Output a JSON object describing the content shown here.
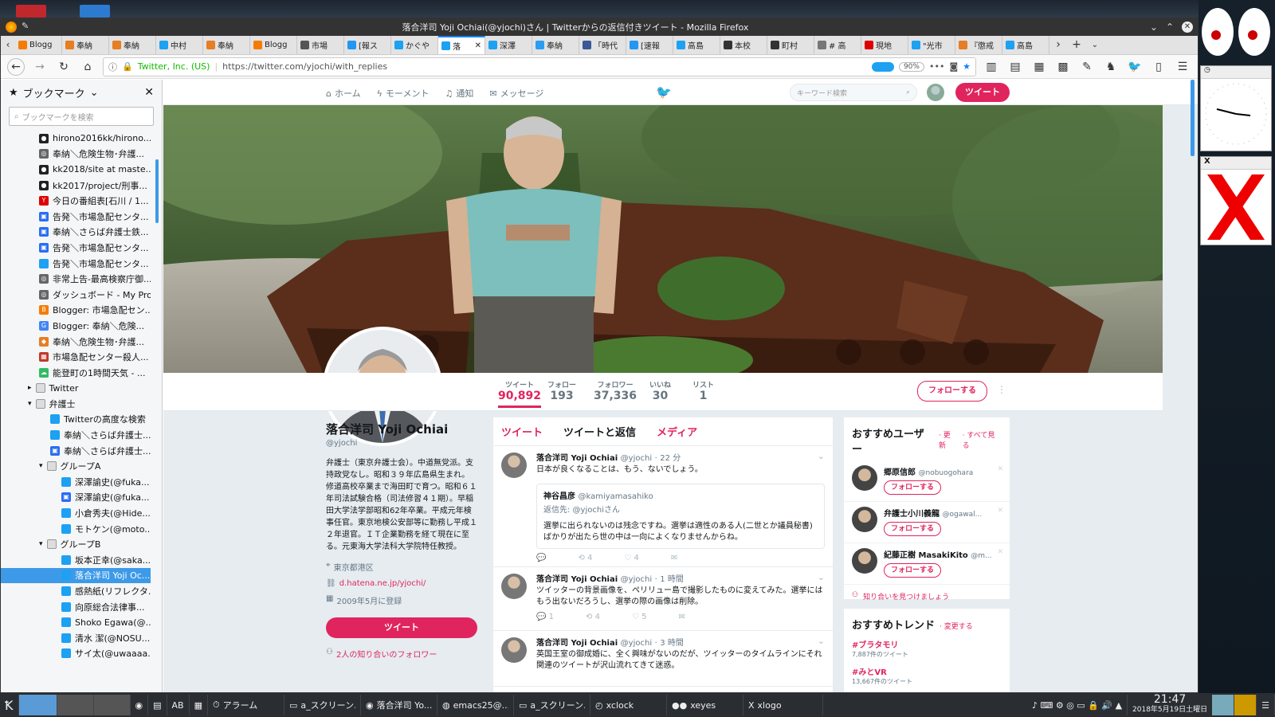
{
  "browser": {
    "window_title": "落合洋司 Yoji Ochiai(@yjochi)さん | Twitterからの返信付きツイート - Mozilla Firefox",
    "tabs": [
      {
        "label": "Blogg",
        "color": "#f57c00"
      },
      {
        "label": "奉納",
        "color": "#e67e22"
      },
      {
        "label": "奉納",
        "color": "#e67e22"
      },
      {
        "label": "中村",
        "color": "#1da1f2"
      },
      {
        "label": "奉納",
        "color": "#e67e22"
      },
      {
        "label": "Blogg",
        "color": "#f57c00"
      },
      {
        "label": "市場",
        "color": "#555"
      },
      {
        "label": "[報ス",
        "color": "#2196f3"
      },
      {
        "label": "かぐや",
        "color": "#1da1f2"
      },
      {
        "label": "落",
        "color": "#1da1f2",
        "active": true
      },
      {
        "label": "深澤",
        "color": "#1da1f2"
      },
      {
        "label": "奉納",
        "color": "#2a9df4"
      },
      {
        "label": "「時代",
        "color": "#3b5998"
      },
      {
        "label": "[速報",
        "color": "#2196f3"
      },
      {
        "label": "高島",
        "color": "#1da1f2"
      },
      {
        "label": "本校",
        "color": "#333"
      },
      {
        "label": "町村",
        "color": "#333"
      },
      {
        "label": "# 高",
        "color": "#777"
      },
      {
        "label": "現地",
        "color": "#d00"
      },
      {
        "label": "\"光市",
        "color": "#1da1f2"
      },
      {
        "label": "『懲戒",
        "color": "#e67e22"
      },
      {
        "label": "高島",
        "color": "#1da1f2"
      }
    ],
    "site_identity": "Twitter, Inc. (US)",
    "url": "https://twitter.com/yjochi/with_replies",
    "zoom": "90%"
  },
  "sidebar": {
    "title": "ブックマーク",
    "search_placeholder": "ブックマークを検索",
    "items": [
      {
        "label": "hirono2016kk/hirono...",
        "icon": "github",
        "indent": 0
      },
      {
        "label": "奉納＼危険生物･弁護...",
        "icon": "globe",
        "indent": 0
      },
      {
        "label": "kk2018/site at maste...",
        "icon": "github",
        "indent": 0
      },
      {
        "label": "kk2017/project/刑事...",
        "icon": "github",
        "indent": 0
      },
      {
        "label": "今日の番組表[石川 / 1...",
        "icon": "yahoo",
        "indent": 0
      },
      {
        "label": "告発＼市場急配センタ...",
        "icon": "blue",
        "indent": 0
      },
      {
        "label": "奉納＼さらば弁護士鉄...",
        "icon": "blue",
        "indent": 0
      },
      {
        "label": "告発＼市場急配センタ...",
        "icon": "blue",
        "indent": 0
      },
      {
        "label": "告発＼市場急配センタ...",
        "icon": "twitter",
        "indent": 0
      },
      {
        "label": "非常上告-最高検察庁御...",
        "icon": "globe",
        "indent": 0
      },
      {
        "label": "ダッシュボード - My Pro...",
        "icon": "globe",
        "indent": 0
      },
      {
        "label": "Blogger: 市場急配セン...",
        "icon": "blogger",
        "indent": 0
      },
      {
        "label": "Blogger: 奉納＼危険...",
        "icon": "google",
        "indent": 0
      },
      {
        "label": "奉納＼危険生物･弁護...",
        "icon": "orange",
        "indent": 0
      },
      {
        "label": "市場急配センター殺人...",
        "icon": "grid",
        "indent": 0
      },
      {
        "label": "能登町の1時間天気 - ...",
        "icon": "weather",
        "indent": 0
      },
      {
        "label": "Twitter",
        "icon": "folder-closed",
        "indent": 0
      },
      {
        "label": "弁護士",
        "icon": "folder-open",
        "indent": 0
      },
      {
        "label": "Twitterの高度な検索",
        "icon": "twitter",
        "indent": 1
      },
      {
        "label": "奉納＼さらば弁護士...",
        "icon": "twitter",
        "indent": 1
      },
      {
        "label": "奉納＼さらば弁護士...",
        "icon": "blue",
        "indent": 1
      },
      {
        "label": "グループA",
        "icon": "folder-open",
        "indent": 1
      },
      {
        "label": "深澤諭史(@fuka...",
        "icon": "twitter",
        "indent": 2
      },
      {
        "label": "深澤諭史(@fuka...",
        "icon": "blue",
        "indent": 2
      },
      {
        "label": "小倉秀夫(@Hide...",
        "icon": "twitter",
        "indent": 2
      },
      {
        "label": "モトケン(@moto...",
        "icon": "twitter",
        "indent": 2
      },
      {
        "label": "グループB",
        "icon": "folder-open",
        "indent": 1
      },
      {
        "label": "坂本正幸(@saka...",
        "icon": "twitter",
        "indent": 2
      },
      {
        "label": "落合洋司 Yoji Oc...",
        "icon": "twitter",
        "indent": 2,
        "selected": true
      },
      {
        "label": "感熱紙(リフレクタ...",
        "icon": "twitter",
        "indent": 2
      },
      {
        "label": "向原総合法律事...",
        "icon": "twitter",
        "indent": 2
      },
      {
        "label": "Shoko Egawa(@...",
        "icon": "twitter",
        "indent": 2
      },
      {
        "label": "清水 潔(@NOSU...",
        "icon": "twitter",
        "indent": 2
      },
      {
        "label": "サイ太(@uwaaaa...",
        "icon": "twitter",
        "indent": 2
      }
    ]
  },
  "twitter": {
    "nav": {
      "home": "ホーム",
      "moments": "モーメント",
      "notifications": "通知",
      "messages": "メッセージ",
      "search_placeholder": "キーワード検索",
      "tweet_button": "ツイート"
    },
    "stats": [
      {
        "label": "ツイート",
        "value": "90,892",
        "active": true
      },
      {
        "label": "フォロー",
        "value": "193"
      },
      {
        "label": "フォロワー",
        "value": "37,336"
      },
      {
        "label": "いいね",
        "value": "30"
      },
      {
        "label": "リスト",
        "value": "1"
      }
    ],
    "follow_button": "フォローする",
    "profile": {
      "name": "落合洋司 Yoji Ochiai",
      "handle": "@yjochi",
      "bio": "弁護士（東京弁護士会）。中道無党派。支持政党なし。昭和３９年広島県生まれ。修道高校卒業まで海田町で育つ。昭和６１年司法試験合格（司法修習４１期）。早稲田大学法学部昭和62年卒業。平成元年検事任官。東京地検公安部等に勤務し平成１２年退官。ＩＴ企業勤務を経て現在に至る。元東海大学法科大学院特任教授。",
      "location": "東京都港区",
      "link": "d.hatena.ne.jp/yjochi/",
      "joined": "2009年5月に登録",
      "tweet_button": "ツイート",
      "followers_you_know": "2人の知り合いのフォロワー"
    },
    "timeline_tabs": [
      "ツイート",
      "ツイートと返信",
      "メディア"
    ],
    "tweets": [
      {
        "name": "落合洋司 Yoji Ochiai",
        "handle": "@yjochi",
        "time": "22 分",
        "text": "日本が良くなることは、もう、ないでしょう。",
        "quote": {
          "name": "神谷昌彦",
          "handle": "@kamiyamasahiko",
          "reply_to": "返信先: @yjochiさん",
          "text": "選挙に出られないのは残念ですね。選挙は適性のある人(二世とか議員秘書)ばかりが出たら世の中は一向によくなりませんからね。"
        },
        "replies": "",
        "retweets": "4",
        "likes": "4"
      },
      {
        "name": "落合洋司 Yoji Ochiai",
        "handle": "@yjochi",
        "time": "1 時間",
        "text": "ツイッターの背景画像を、ペリリュー島で撮影したものに変えてみた。選挙にはもう出ないだろうし、選挙の際の画像は削除。",
        "replies": "1",
        "retweets": "4",
        "likes": "5"
      },
      {
        "name": "落合洋司 Yoji Ochiai",
        "handle": "@yjochi",
        "time": "3 時間",
        "text": "英国王室の御成婚に、全く興味がないのだが、ツイッターのタイムラインにそれ関連のツイートが沢山流れてきて迷惑。"
      }
    ],
    "suggestions": {
      "title": "おすすめユーザー",
      "refresh": "更新",
      "see_all": "すべて見る",
      "users": [
        {
          "name": "郷原信郎",
          "handle": "@nobuogohara",
          "button": "フォローする"
        },
        {
          "name": "弁護士小川義龍",
          "handle": "@ogawal...",
          "button": "フォローする"
        },
        {
          "name": "紀藤正樹 MasakiKito",
          "handle": "@m...",
          "button": "フォローする"
        }
      ],
      "find_friends": "知り合いを見つけましょう"
    },
    "trends": {
      "title": "おすすめトレンド",
      "change": "変更する",
      "items": [
        {
          "tag": "#ブラタモリ",
          "count": "7,887件のツイート"
        },
        {
          "tag": "#みとVR",
          "count": "13,667件のツイート"
        }
      ]
    }
  },
  "taskbar": {
    "tasks": [
      "アラーム",
      "a_スクリーン...",
      "落合洋司 Yo...",
      "emacs25@...",
      "a_スクリーン...",
      "xclock",
      "xeyes",
      "xlogo"
    ],
    "time": "21:47",
    "date": "2018年5月19日土曜日"
  }
}
